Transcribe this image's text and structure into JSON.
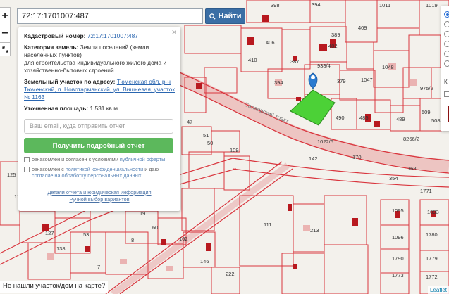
{
  "search": {
    "value": "72:17:1701007:487",
    "button_label": "Найти",
    "icon": "search-icon"
  },
  "zoom": {
    "in": "+",
    "out": "−"
  },
  "info": {
    "close": "×",
    "cadastral_label": "Кадастровый номер:",
    "cadastral_value": "72:17:1701007:487",
    "category_label": "Категория земель:",
    "category_value": "Земли поселений (земли населенных пунктов)",
    "purpose": "для строительства индивидуального жилого дома и хозяйственно-бытовых строений",
    "address_label": "Земельный участок по адресу:",
    "address_value": "Тюменская обл, р-н Тюменский, п. Новотарманский, ул. Вишневая, участок № 1163",
    "area_label": "Уточненная площадь:",
    "area_value": "1 531 кв.м.",
    "email_placeholder": "Ваш email, куда отправить отчет",
    "report_button": "Получить подробный отчет",
    "consent1_text": "ознакомлен и согласен с условиями ",
    "consent1_link": "публичной оферты",
    "consent2_text": "ознакомлен с ",
    "consent2_link": "политикой конфиденциальности",
    "consent2_mid": " и даю ",
    "consent2_link2": "согласие на обработку персональных данных",
    "details_link": "Детали отчета и юридическая информация",
    "manual_link": "Ручной выбор вариантов"
  },
  "right_panel": {
    "letter": "К"
  },
  "bottom_note": "Не нашли участок/дом на карте?",
  "attribution": "Leaflet",
  "colors": {
    "boundary": "#d9363e",
    "selected_parcel": "#4cd137",
    "building": "#b8191f",
    "marker": "#2a7bd0",
    "report_button": "#5cb85c",
    "find_button": "#3a6ea5"
  }
}
